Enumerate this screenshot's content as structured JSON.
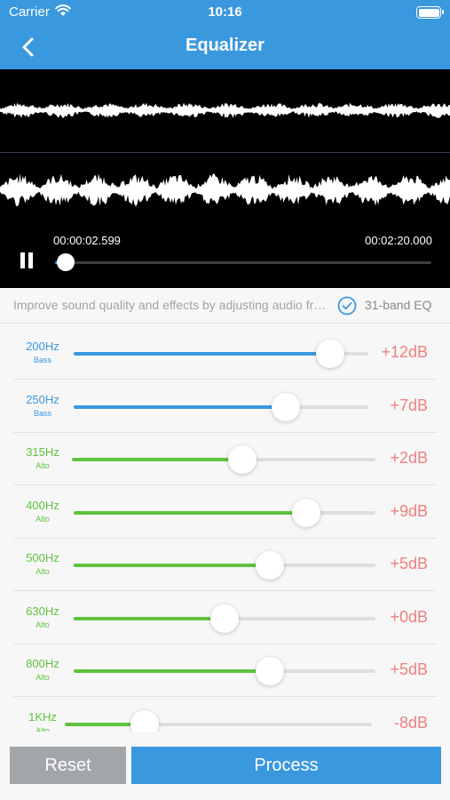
{
  "status_bar": {
    "carrier": "Carrier",
    "time": "10:16"
  },
  "nav": {
    "title": "Equalizer"
  },
  "player": {
    "current_time": "00:00:02.599",
    "total_time": "00:02:20.000",
    "progress": 0.029
  },
  "info": {
    "description": "Improve sound quality and effects by adjusting audio frequencies",
    "eq_mode_label": "31-band EQ",
    "eq_mode_checked": true
  },
  "bands": [
    {
      "freq": "200Hz",
      "type": "Bass",
      "gain": "+12dB",
      "level": 0.87,
      "color": "#3a98df"
    },
    {
      "freq": "250Hz",
      "type": "Bass",
      "gain": "+7dB",
      "level": 0.72,
      "color": "#3a98df"
    },
    {
      "freq": "315Hz",
      "type": "Alto",
      "gain": "+2dB",
      "level": 0.56,
      "color": "#5fc33f"
    },
    {
      "freq": "400Hz",
      "type": "Alto",
      "gain": "+9dB",
      "level": 0.77,
      "color": "#5fc33f"
    },
    {
      "freq": "500Hz",
      "type": "Alto",
      "gain": "+5dB",
      "level": 0.65,
      "color": "#5fc33f"
    },
    {
      "freq": "630Hz",
      "type": "Alto",
      "gain": "+0dB",
      "level": 0.5,
      "color": "#5fc33f"
    },
    {
      "freq": "800Hz",
      "type": "Alto",
      "gain": "+5dB",
      "level": 0.65,
      "color": "#5fc33f"
    },
    {
      "freq": "1KHz",
      "type": "Alto",
      "gain": "-8dB",
      "level": 0.26,
      "color": "#5fc33f"
    }
  ],
  "buttons": {
    "reset": "Reset",
    "process": "Process"
  },
  "colors": {
    "accent": "#3a98df",
    "bass": "#3a98df",
    "alto": "#5fc33f",
    "gain_text": "#ee7f7f"
  },
  "icons": {
    "back": "chevron-left-icon",
    "wifi": "wifi-icon",
    "battery": "battery-icon",
    "pause": "pause-icon",
    "check": "checkmark-circle-icon"
  }
}
